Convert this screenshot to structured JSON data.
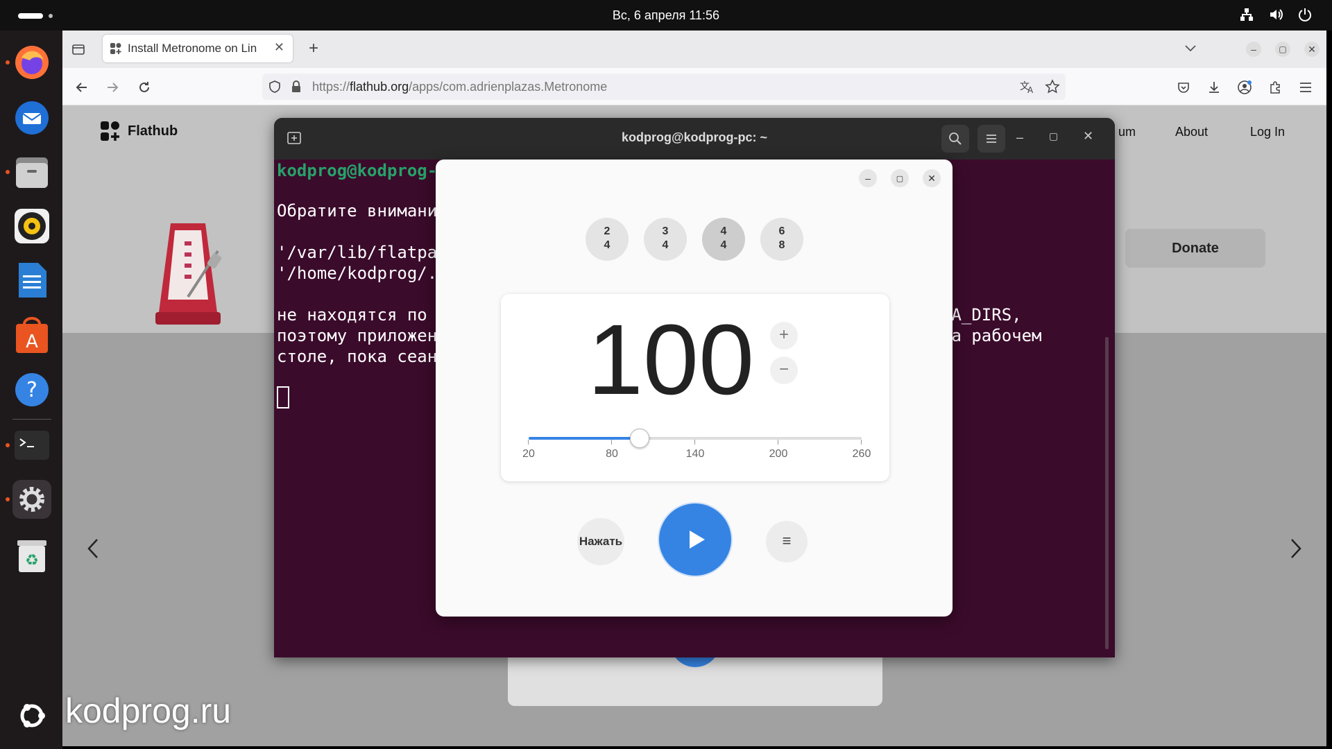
{
  "topbar": {
    "clock": "Вс, 6 апреля  11:56"
  },
  "dock": {
    "apps": [
      "firefox-icon",
      "thunderbird-icon",
      "files-icon",
      "rhythmbox-icon",
      "writer-icon",
      "app-center-icon",
      "help-icon",
      "terminal-icon",
      "settings-icon",
      "trash-icon"
    ],
    "bottom_icon": "ubuntu-logo"
  },
  "browser": {
    "tab_title": "Install Metronome on Lin",
    "url_prefix": "https://",
    "url_domain": "flathub.org",
    "url_path": "/apps/com.adrienplazas.Metronome"
  },
  "flathub": {
    "logo_text": "Flathub",
    "nav_forum_partial": "um",
    "nav_about": "About",
    "nav_login": "Log In",
    "donate_label": "Donate"
  },
  "terminal": {
    "title": "kodprog@kodprog-pc: ~",
    "prompt": "kodprog@kodprog-",
    "line1": "Обратите внимани",
    "line2": "'/var/lib/flatpa",
    "line3": "'/home/kodprog/.",
    "line4": "не находятся по",
    "line5": "поэтому приложен",
    "line6": "столе, пока сеан",
    "right1": "TA_DIRS,",
    "right2": "на рабочем"
  },
  "metronome": {
    "signatures": [
      {
        "top": "2",
        "bottom": "4",
        "selected": false
      },
      {
        "top": "3",
        "bottom": "4",
        "selected": false
      },
      {
        "top": "4",
        "bottom": "4",
        "selected": true
      },
      {
        "top": "6",
        "bottom": "8",
        "selected": false
      }
    ],
    "bpm": "100",
    "increase_label": "+",
    "decrease_label": "−",
    "slider": {
      "min": 20,
      "max": 260,
      "value": 100
    },
    "ticks": [
      "20",
      "80",
      "140",
      "200",
      "260"
    ],
    "tap_label": "Нажать",
    "menu_label": "≡"
  },
  "watermark": "kodprog.ru",
  "colors": {
    "accent": "#3584e4",
    "terminal_bg": "#3b0b2b",
    "prompt_green": "#26a269",
    "ubuntu_orange": "#e95420"
  }
}
